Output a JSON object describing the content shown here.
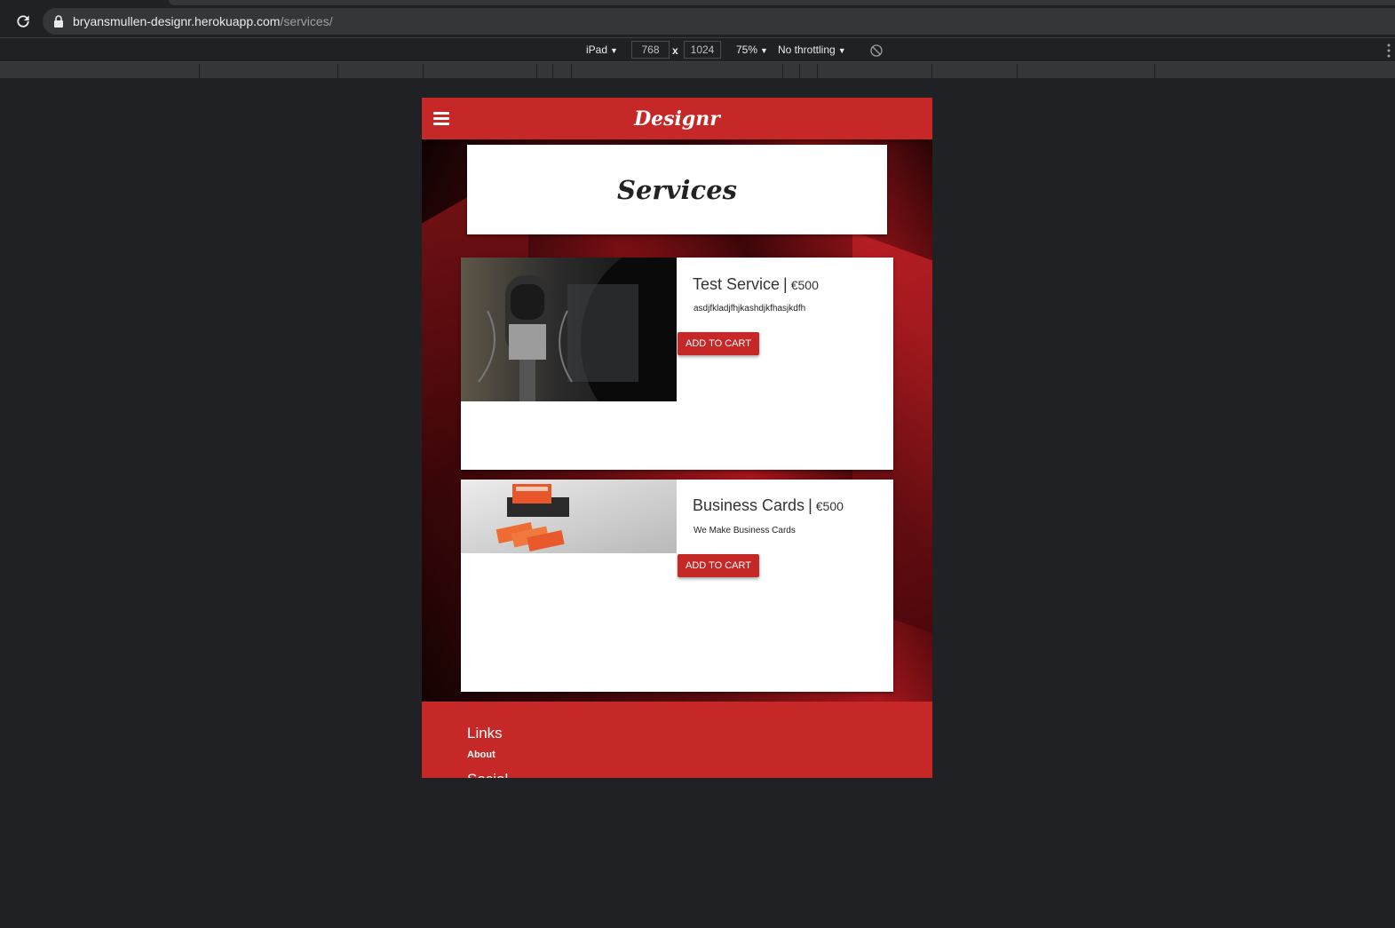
{
  "browser": {
    "url_host": "bryansmullen-designr.herokuapp.com",
    "url_path": "/services/"
  },
  "devtools": {
    "device": "iPad",
    "width": "768",
    "times": "x",
    "height": "1024",
    "zoom": "75%",
    "throttling": "No throttling"
  },
  "site": {
    "brand": "Designr",
    "page_title": "Services",
    "services": [
      {
        "name": "Test Service",
        "separator": "|",
        "price": "€500",
        "description": "asdjfkladjfhjkashdjkfhasjkdfh",
        "button": "ADD TO CART"
      },
      {
        "name": "Business Cards",
        "separator": "|",
        "price": "€500",
        "description": "We Make Business Cards",
        "button": "ADD TO CART"
      }
    ],
    "footer": {
      "links_heading": "Links",
      "about_link": "About",
      "social_heading": "Social"
    }
  },
  "colors": {
    "brand_red": "#c62828",
    "chrome_bg": "#202124"
  }
}
